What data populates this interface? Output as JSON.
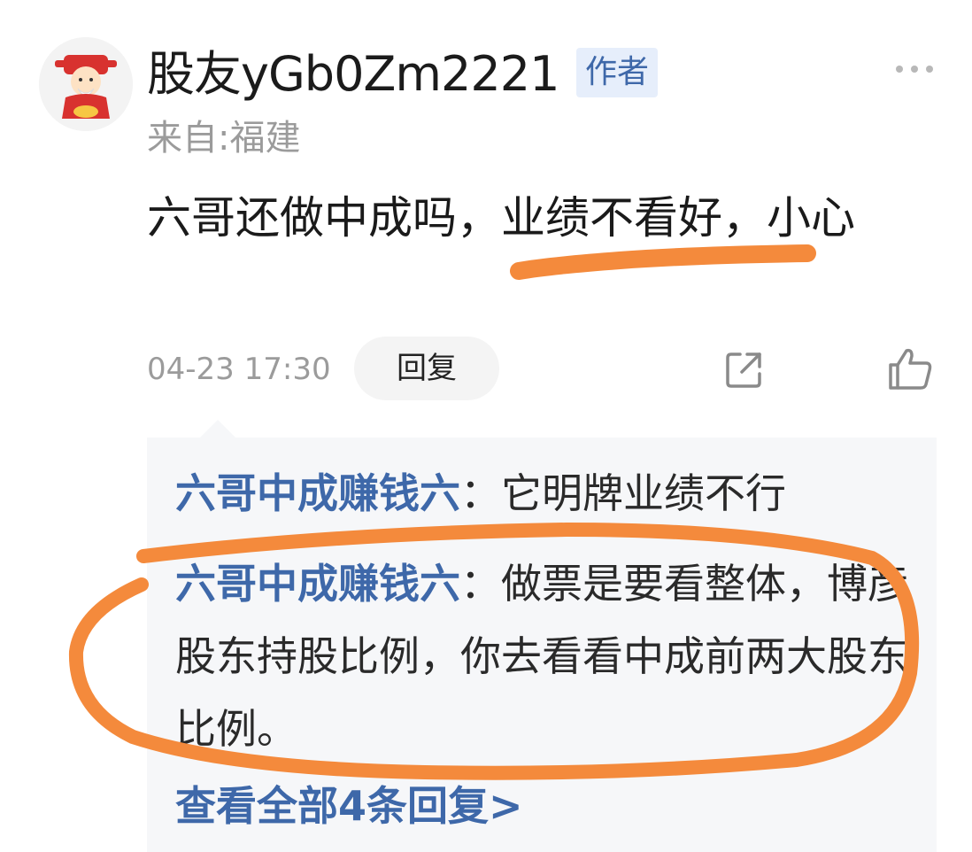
{
  "user": {
    "name": "股友yGb0Zm2221",
    "badge": "作者",
    "location": "来自:福建"
  },
  "comment": {
    "text_before": "六哥还做中成吗，",
    "text_highlight": "业绩不看好",
    "text_after": "，小心",
    "time": "04-23 17:30"
  },
  "actions": {
    "reply_label": "回复"
  },
  "replies": [
    {
      "author": "六哥中成赚钱六",
      "separator": "：",
      "text": "它明牌业绩不行"
    },
    {
      "author": "六哥中成赚钱六",
      "separator": "：",
      "text": "做票是要看整体，博彦股东持股比例，你去看看中成前两大股东比例。"
    }
  ],
  "view_all_label": "查看全部4条回复>",
  "colors": {
    "link_blue": "#3e68a9",
    "annotation_orange": "#f48a3c",
    "badge_bg": "#e6eefb"
  },
  "icons": [
    "avatar",
    "more-icon",
    "share-icon",
    "like-icon"
  ]
}
